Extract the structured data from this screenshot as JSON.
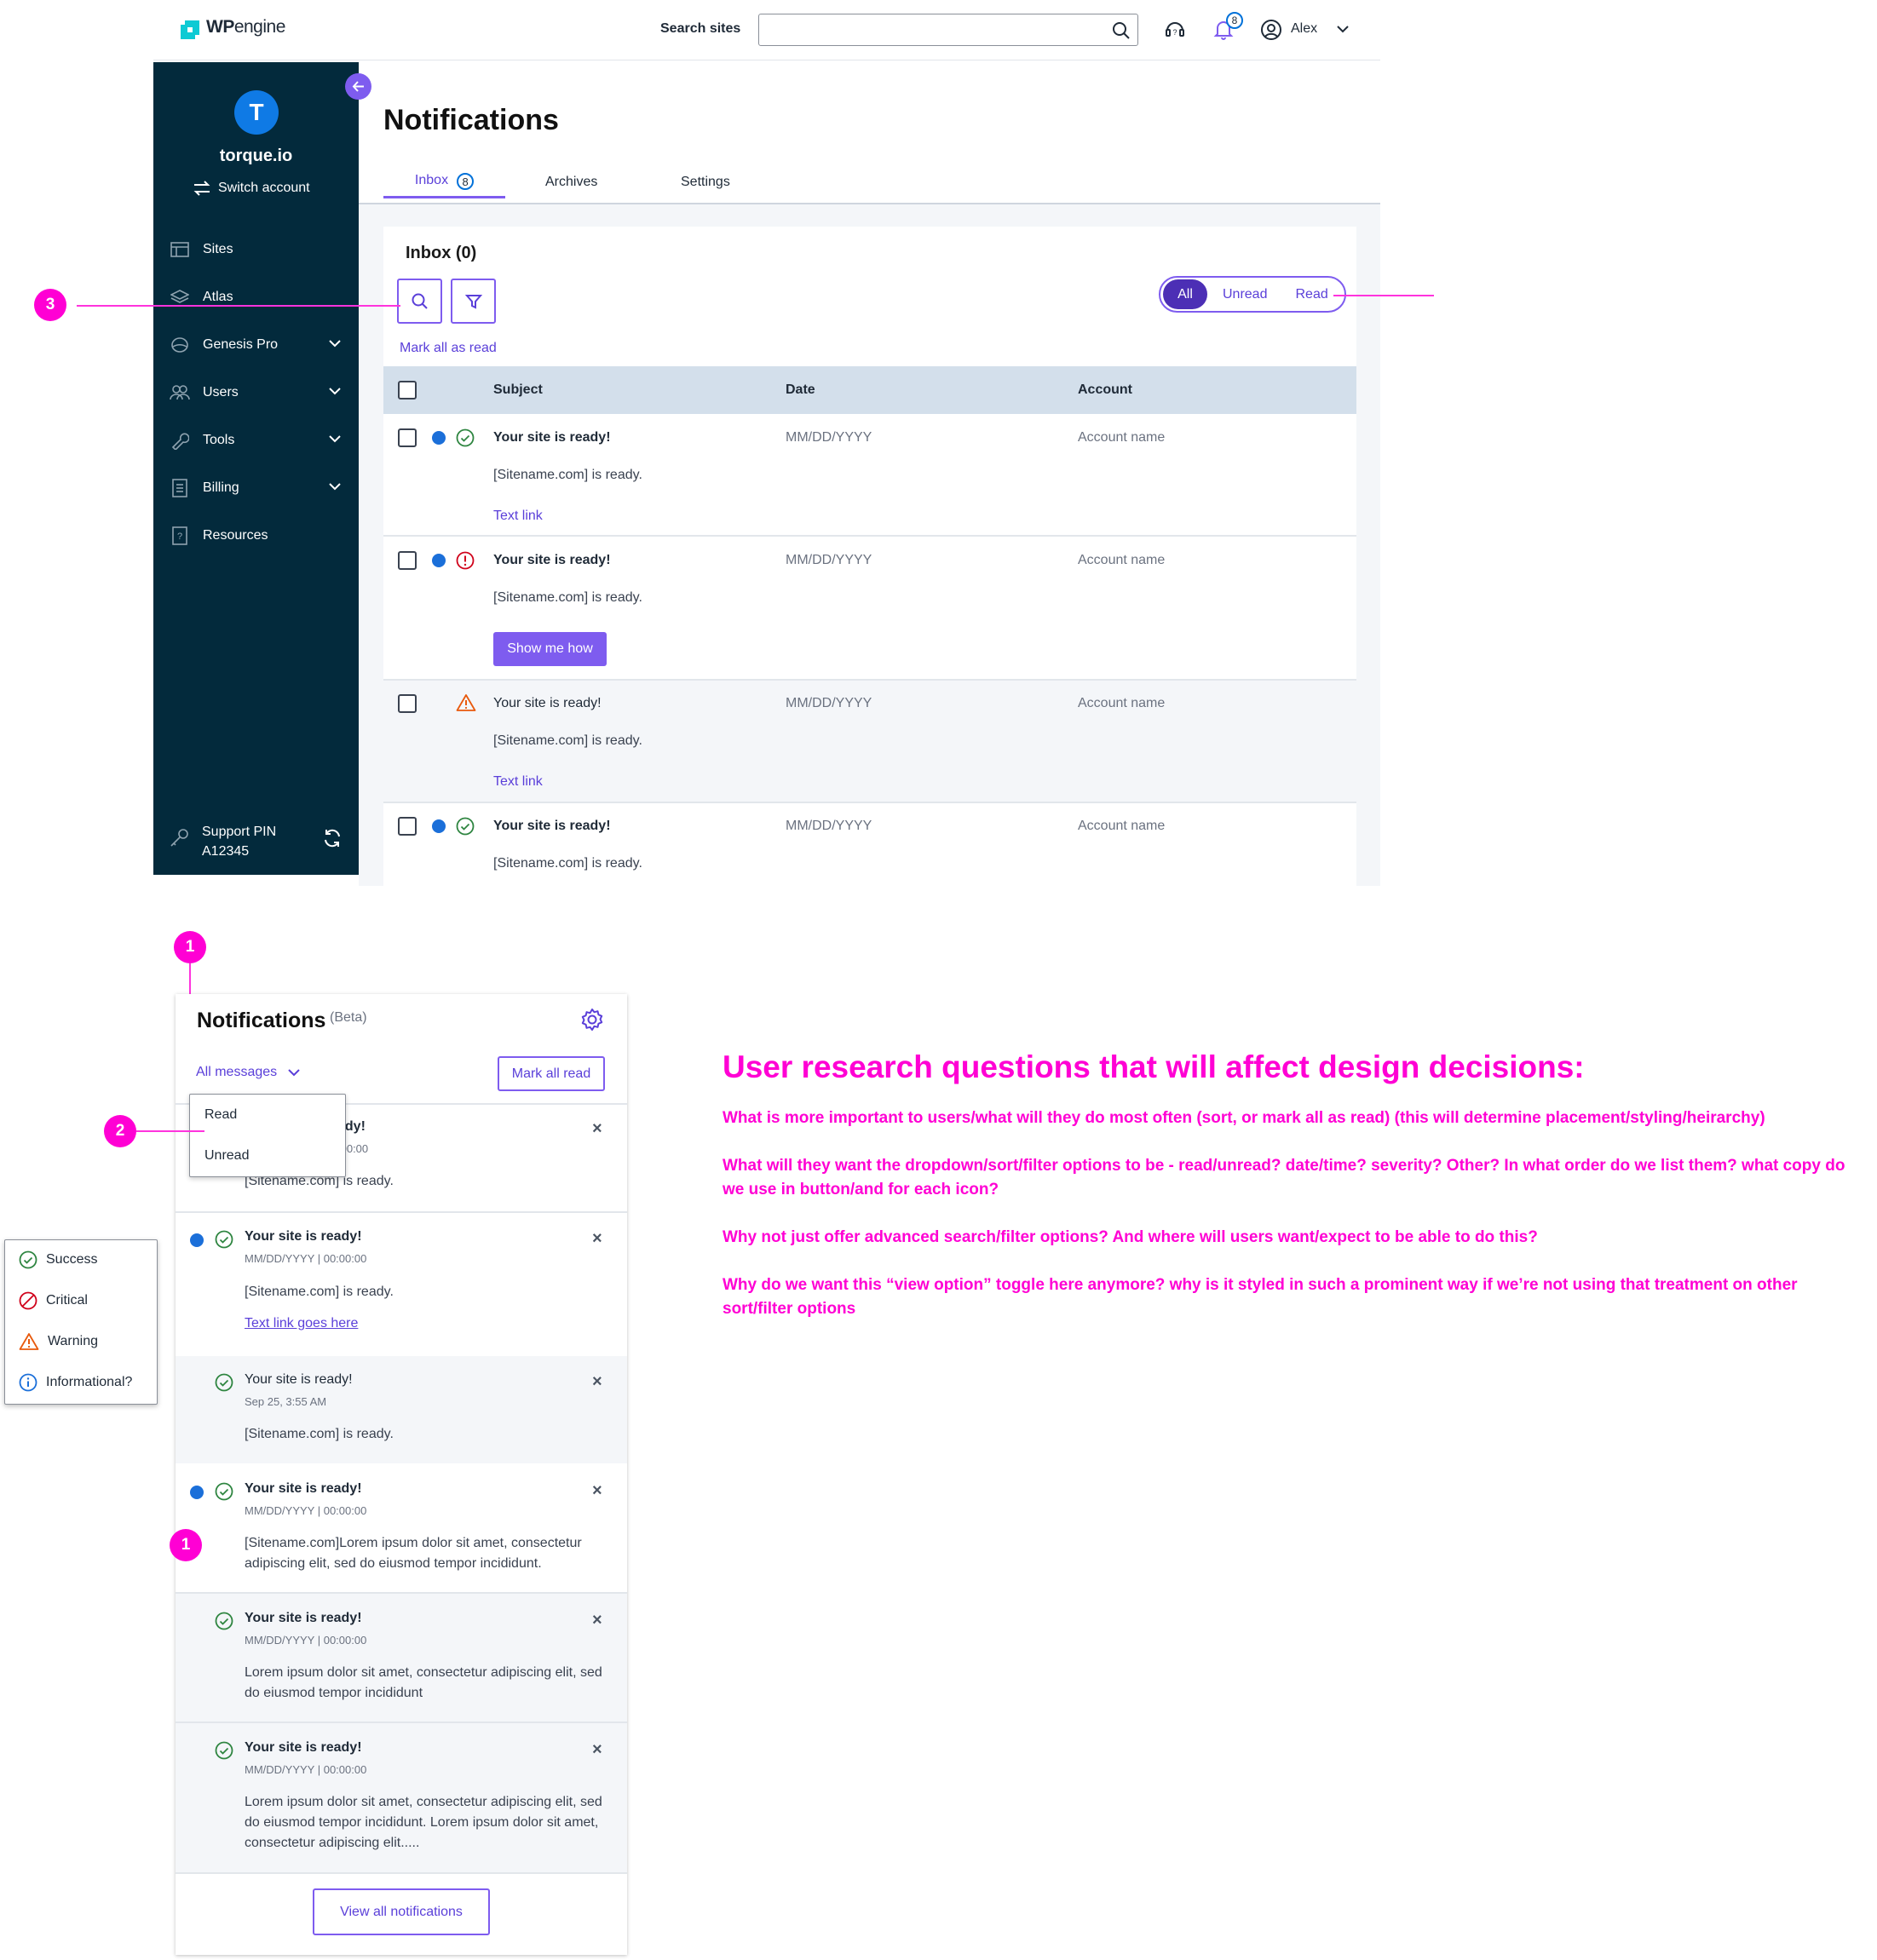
{
  "header": {
    "logo_text": "engine",
    "logo_bold": "WP",
    "search_label": "Search sites",
    "search_placeholder": "",
    "notif_count": "8",
    "user_name": "Alex"
  },
  "sidebar": {
    "avatar_initial": "T",
    "account_name": "torque.io",
    "switch_label": "Switch account",
    "items": [
      {
        "label": "Sites",
        "icon": "sites-icon"
      },
      {
        "label": "Atlas",
        "icon": "layers-icon"
      },
      {
        "label": "Genesis Pro",
        "icon": "genesis-icon"
      },
      {
        "label": "Users",
        "icon": "users-icon"
      },
      {
        "label": "Tools",
        "icon": "wrench-icon"
      },
      {
        "label": "Billing",
        "icon": "billing-icon"
      },
      {
        "label": "Resources",
        "icon": "resources-icon"
      }
    ],
    "support_label": "Support PIN",
    "support_pin": "A12345"
  },
  "main": {
    "title": "Notifications",
    "tabs": [
      {
        "label": "Inbox",
        "badge": "8"
      },
      {
        "label": "Archives"
      },
      {
        "label": "Settings"
      }
    ],
    "inbox_title": "Inbox (0)",
    "toggle": [
      "All",
      "Unread",
      "Read"
    ],
    "mark_all_link": "Mark all as read",
    "columns": [
      "Subject",
      "Date",
      "Account"
    ],
    "rows": [
      {
        "subject": "Your site is ready!",
        "body": "[Sitename.com] is ready.",
        "date": "MM/DD/YYYY",
        "account": "Account name",
        "action": "Text link",
        "status": "success"
      },
      {
        "subject": "Your site is ready!",
        "body": "[Sitename.com] is ready.",
        "date": "MM/DD/YYYY",
        "account": "Account name",
        "action": "Show me how",
        "status": "critical"
      },
      {
        "subject": "Your site is ready!",
        "body": "[Sitename.com] is ready.",
        "date": "MM/DD/YYYY",
        "account": "Account name",
        "action": "Text link",
        "status": "warning"
      },
      {
        "subject": "Your site is ready!",
        "body": "[Sitename.com] is ready.",
        "date": "MM/DD/YYYY",
        "account": "Account name",
        "status": "success"
      }
    ]
  },
  "annotations": {
    "n1": "1",
    "n2": "2",
    "n3": "3"
  },
  "panel": {
    "title": "Notifications",
    "beta": "(Beta)",
    "filter_label": "All messages",
    "mark_all_button": "Mark all read",
    "dropdown": [
      "Read",
      "Unread"
    ],
    "hidden_row": {
      "subject_tail": "ady!",
      "meta_tail": ":00:00",
      "body": "[Sitename.com] is ready."
    },
    "items": [
      {
        "subject": "Your site is ready!",
        "meta": "MM/DD/YYYY  |  00:00:00",
        "body": "[Sitename.com] is ready.",
        "link": "Text link goes here"
      },
      {
        "subject": "Your site is ready!",
        "meta": "Sep 25, 3:55 AM",
        "body": "[Sitename.com] is ready."
      },
      {
        "subject": "Your site is ready!",
        "meta": "MM/DD/YYYY  |  00:00:00",
        "body": "[Sitename.com]Lorem ipsum dolor sit amet, consectetur adipiscing elit, sed do eiusmod tempor incididunt."
      },
      {
        "subject": "Your site is ready!",
        "meta": "MM/DD/YYYY  |  00:00:00",
        "body": "Lorem ipsum dolor sit amet, consectetur adipiscing elit, sed do eiusmod tempor incididunt"
      },
      {
        "subject": "Your site is ready!",
        "meta": "MM/DD/YYYY  |  00:00:00",
        "body": "Lorem ipsum dolor sit amet, consectetur adipiscing elit, sed do eiusmod tempor incididunt. Lorem ipsum dolor sit amet, consectetur adipiscing elit....."
      }
    ],
    "close_glyph": "×",
    "view_all": "View all notifications"
  },
  "legend": [
    "Success",
    "Critical",
    "Warning",
    "Informational?"
  ],
  "research": {
    "title": "User research questions that will affect design decisions:",
    "questions": [
      "What is more important to users/what will they do most often (sort, or mark all as read) (this will determine placement/styling/heirarchy)",
      "What will they want the dropdown/sort/filter options to be - read/unread? date/time? severity? Other? In what order do we list them? what copy do we use in button/and for each icon?",
      "Why not just offer advanced search/filter options? And where will users want/expect to be able to do this?",
      "Why do we want this “view option” toggle here anymore? why is it styled in such a prominent way if we’re not using that treatment on other sort/filter options"
    ]
  },
  "colors": {
    "accent": "#7e5cef",
    "sidebar": "#032a3c",
    "annotation": "#ff00d4",
    "success": "#2e8540",
    "critical": "#d0021b",
    "warning": "#e8590c",
    "info": "#1b6fd9"
  }
}
